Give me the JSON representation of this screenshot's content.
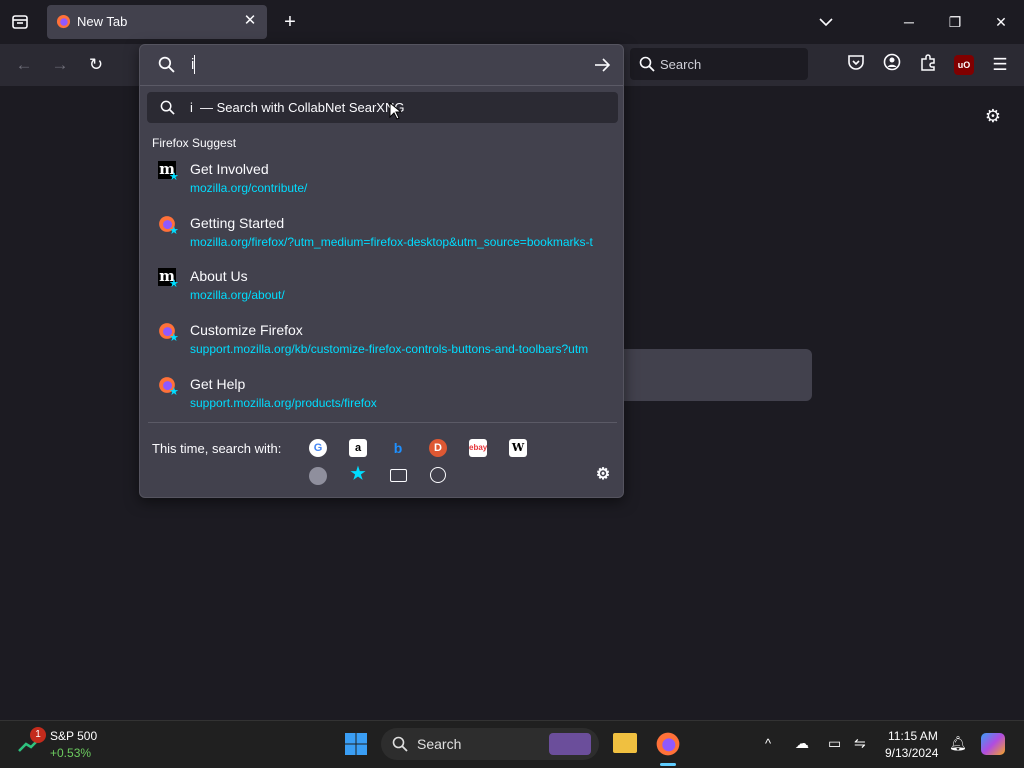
{
  "tabs": [
    {
      "title": "New Tab"
    }
  ],
  "toolbar": {
    "search_placeholder": "Search"
  },
  "urlbar": {
    "input_value": "i",
    "heuristic": {
      "query": "i",
      "description": "— Search with CollabNet SearXNG"
    },
    "group_label": "Firefox Suggest",
    "results": [
      {
        "title": "Get Involved",
        "url": "mozilla.org/contribute/",
        "icon": "mozilla-m-icon"
      },
      {
        "title": "Getting Started",
        "url": "mozilla.org/firefox/?utm_medium=firefox-desktop&utm_source=bookmarks-t",
        "icon": "firefox-icon"
      },
      {
        "title": "About Us",
        "url": "mozilla.org/about/",
        "icon": "mozilla-m-icon"
      },
      {
        "title": "Customize Firefox",
        "url": "support.mozilla.org/kb/customize-firefox-controls-buttons-and-toolbars?utm",
        "icon": "firefox-icon"
      },
      {
        "title": "Get Help",
        "url": "support.mozilla.org/products/firefox",
        "icon": "firefox-icon"
      }
    ],
    "oneoff_label": "This time, search with:",
    "engines": [
      "google-icon",
      "amazon-icon",
      "bing-icon",
      "duckduckgo-icon",
      "ebay-icon",
      "wikipedia-icon"
    ],
    "modes": [
      "searxng-icon",
      "bookmarks-icon",
      "tabs-icon",
      "history-icon"
    ]
  },
  "taskbar": {
    "widget_name": "S&P 500",
    "widget_value": "+0.53%",
    "widget_badge": "1",
    "search_label": "Search",
    "time": "11:15 AM",
    "date": "9/13/2024"
  },
  "colors": {
    "accent": "#00ddff",
    "panel": "#42414d",
    "toolbar": "#2b2a33",
    "background": "#1c1b22"
  }
}
